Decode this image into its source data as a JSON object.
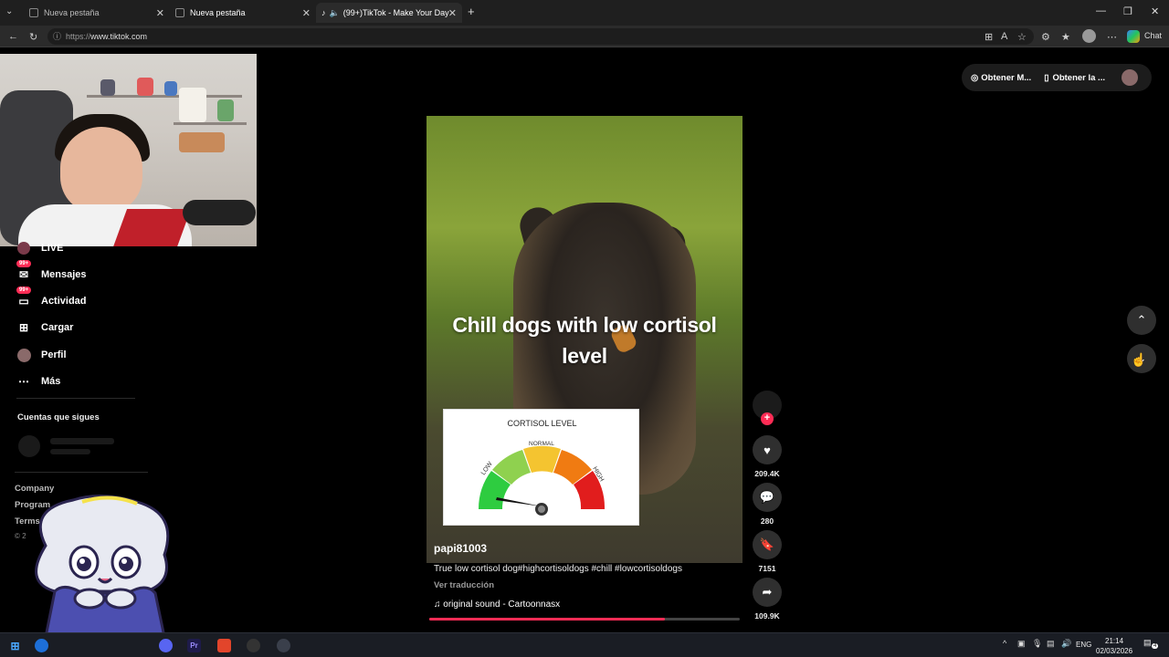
{
  "browser": {
    "tabs": [
      {
        "title": "Nueva pestaña"
      },
      {
        "title": "Nueva pestaña"
      },
      {
        "title": "(99+)TikTok - Make Your Day"
      }
    ],
    "url_proto": "https://",
    "url_host": "www.tiktok.com",
    "chat_label": "Chat"
  },
  "sidebar": {
    "items": [
      {
        "label": "LIVE",
        "icon": "live-icon"
      },
      {
        "label": "Mensajes",
        "icon": "messages-icon",
        "badge": "99+"
      },
      {
        "label": "Actividad",
        "icon": "activity-icon",
        "badge": "99+"
      },
      {
        "label": "Cargar",
        "icon": "upload-icon"
      },
      {
        "label": "Perfil",
        "icon": "profile-icon"
      },
      {
        "label": "Más",
        "icon": "more-icon"
      }
    ],
    "following_header": "Cuentas que sigues",
    "footer": [
      "Company",
      "Program",
      "Terms &",
      "© 2"
    ]
  },
  "top_right": {
    "get_coins": "Obtener M...",
    "get_app": "Obtener la ..."
  },
  "video": {
    "caption": "Chill dogs with low cortisol level",
    "gauge_title": "CORTISOL LEVEL",
    "gauge_labels": {
      "low": "LOW",
      "normal": "NORMAL",
      "high": "HIGH"
    },
    "username": "papi81003",
    "description": "True low cortisol dog#highcortisoldogs  #chill #lowcortisoldogs",
    "translation": "Ver traducción",
    "sound": "original sound - Cartoonnasx",
    "progress": 0.76
  },
  "actions": {
    "likes": "209.4K",
    "comments": "280",
    "saves": "7151",
    "shares": "109.9K"
  },
  "taskbar": {
    "lang": "ENG",
    "time": "21:14",
    "date": "02/03/2026",
    "notif_count": "4"
  },
  "colors": {
    "accent": "#fe2c55",
    "gauge_low": "#2ecc40",
    "gauge_normal": "#f4c430",
    "gauge_high": "#e11d1d"
  }
}
